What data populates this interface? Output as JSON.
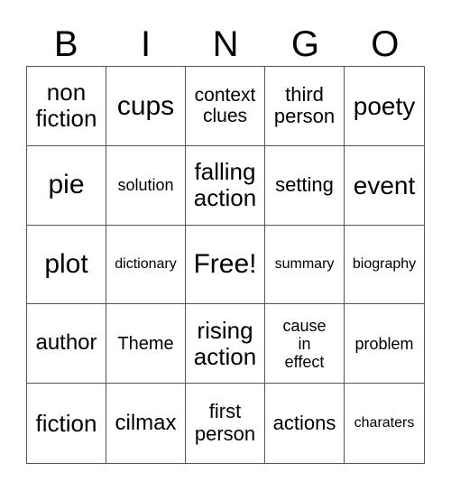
{
  "header": {
    "letters": [
      "B",
      "I",
      "N",
      "G",
      "O"
    ]
  },
  "card": {
    "rows": [
      [
        "non\nfiction",
        "cups",
        "context\nclues",
        "third\nperson",
        "poety"
      ],
      [
        "pie",
        "solution",
        "falling\naction",
        "setting",
        "event"
      ],
      [
        "plot",
        "dictionary",
        "Free!",
        "summary",
        "biography"
      ],
      [
        "author",
        "Theme",
        "rising\naction",
        "cause\nin\neffect",
        "problem"
      ],
      [
        "fiction",
        "cilmax",
        "first\nperson",
        "actions",
        "charaters"
      ]
    ]
  }
}
